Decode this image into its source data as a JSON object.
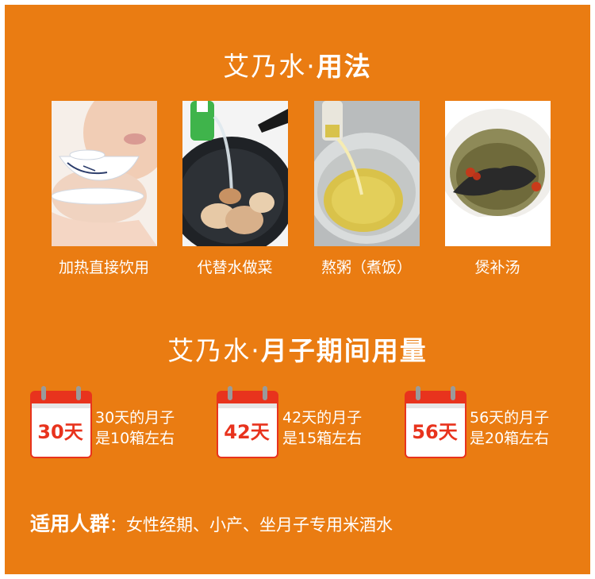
{
  "usage": {
    "title_normal": "艾乃水·",
    "title_bold": "用法",
    "items": [
      {
        "label": "加热直接饮用"
      },
      {
        "label": "代替水做菜"
      },
      {
        "label": "熬粥（煮饭）"
      },
      {
        "label": "煲补汤"
      }
    ]
  },
  "dosage": {
    "title_normal": "艾乃水·",
    "title_bold": "月子期间用量",
    "plans": [
      {
        "badge": "30天",
        "line1": "30天的月子",
        "line2": "是10箱左右"
      },
      {
        "badge": "42天",
        "line1": "42天的月子",
        "line2": "是15箱左右"
      },
      {
        "badge": "56天",
        "line1": "56天的月子",
        "line2": "是20箱左右"
      }
    ]
  },
  "audience": {
    "lead": "适用人群",
    "separator": "：",
    "text": "女性经期、小产、坐月子专用米酒水"
  },
  "colors": {
    "background": "#ea7c12",
    "accent_red": "#e8331d"
  }
}
